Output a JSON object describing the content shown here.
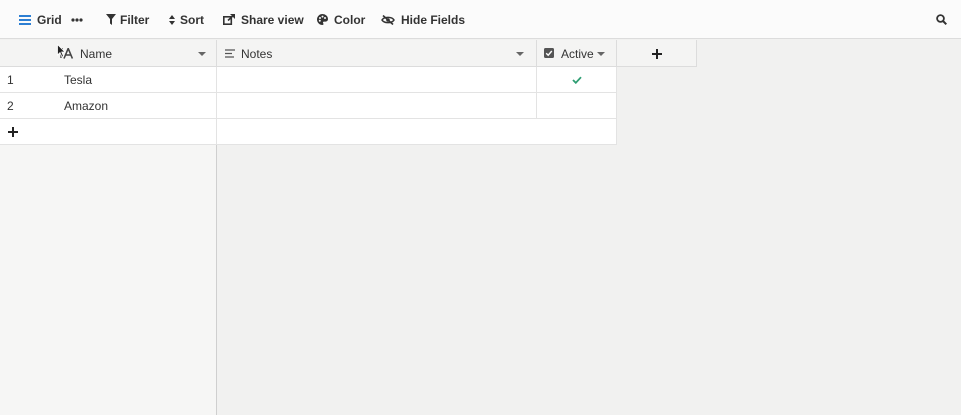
{
  "toolbar": {
    "grid_label": "Grid",
    "filter_label": "Filter",
    "sort_label": "Sort",
    "share_label": "Share view",
    "color_label": "Color",
    "hide_fields_label": "Hide Fields"
  },
  "columns": {
    "name": "Name",
    "notes": "Notes",
    "active": "Active"
  },
  "rows": [
    {
      "index": "1",
      "name": "Tesla",
      "notes": "",
      "active": true
    },
    {
      "index": "2",
      "name": "Amazon",
      "notes": "",
      "active": false
    }
  ],
  "colors": {
    "accent": "#2d7fd3",
    "check": "#2f9e73"
  }
}
